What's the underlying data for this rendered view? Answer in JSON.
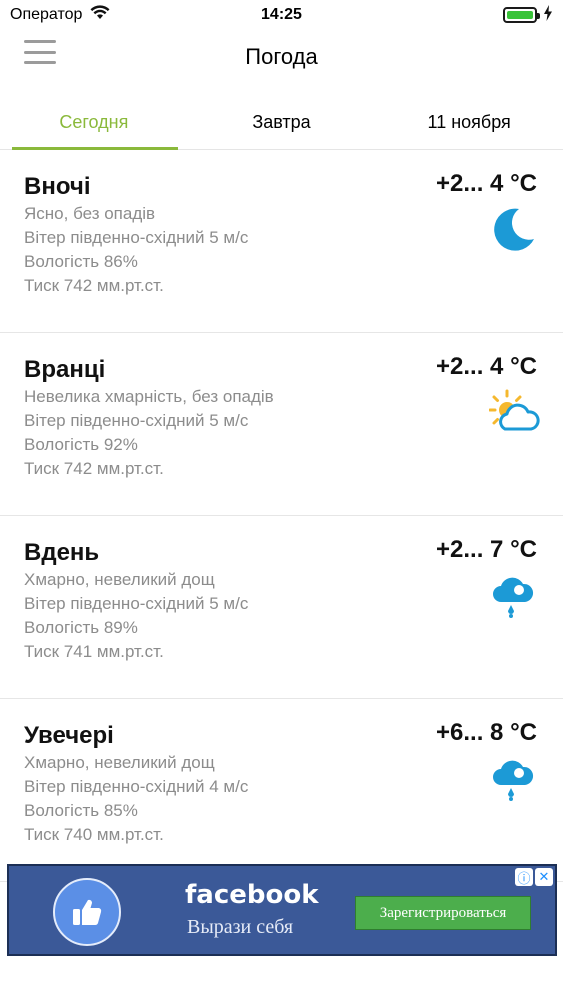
{
  "status_bar": {
    "carrier": "Оператор",
    "time": "14:25",
    "battery_level": 1.0
  },
  "header": {
    "title": "Погода",
    "menu_icon": "hamburger-menu-icon"
  },
  "tabs": [
    {
      "label": "Сегодня",
      "active": true
    },
    {
      "label": "Завтра",
      "active": false
    },
    {
      "label": "11 ноября",
      "active": false
    }
  ],
  "periods": [
    {
      "title": "Вночі",
      "temp": "+2... 4 °C",
      "condition": "Ясно, без опадів",
      "wind": "Вітер південно-східний 5 м/с",
      "humidity": "Вологість 86%",
      "pressure": "Тиск 742 мм.рт.ст.",
      "icon": "moon-icon"
    },
    {
      "title": "Вранці",
      "temp": "+2... 4 °C",
      "condition": "Невелика хмарність, без опадів",
      "wind": "Вітер південно-східний 5 м/с",
      "humidity": "Вологість 92%",
      "pressure": "Тиск 742 мм.рт.ст.",
      "icon": "sun-cloud-icon"
    },
    {
      "title": "Вдень",
      "temp": "+2... 7 °C",
      "condition": "Хмарно, невеликий дощ",
      "wind": "Вітер південно-східний 5 м/с",
      "humidity": "Вологість 89%",
      "pressure": "Тиск 741 мм.рт.ст.",
      "icon": "rain-cloud-icon"
    },
    {
      "title": "Увечері",
      "temp": "+6... 8 °C",
      "condition": "Хмарно, невеликий дощ",
      "wind": "Вітер південно-східний 4 м/с",
      "humidity": "Вологість 85%",
      "pressure": "Тиск 740 мм.рт.ст.",
      "icon": "rain-cloud-icon"
    }
  ],
  "ad": {
    "brand": "facebook",
    "slogan": "Вырази себя",
    "cta": "Зарегистрироваться",
    "info_glyph": "ⓘ",
    "close_glyph": "✕"
  },
  "colors": {
    "accent": "#8ab93b",
    "icon_blue": "#1c9ad6",
    "sun_yellow": "#f5b82e",
    "ad_bg": "#3b5998",
    "ad_cta": "#4cae4c"
  }
}
